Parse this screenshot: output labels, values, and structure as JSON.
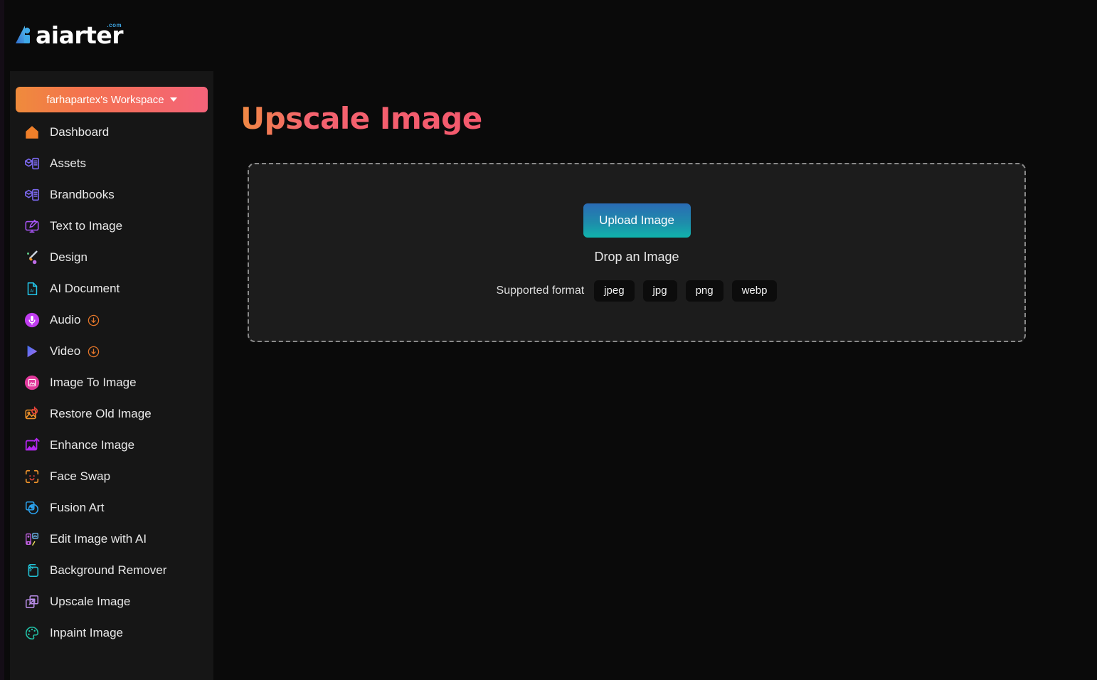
{
  "brand": {
    "name": "aiarter",
    "tld": ".com",
    "mark": "triangle-logo-icon"
  },
  "sidebar": {
    "workspace": {
      "label": "farhapartex's Workspace",
      "caret_icon": "chevron-down-icon",
      "gradient_from": "#ef8b3c",
      "gradient_to": "#f4637a"
    },
    "items": [
      {
        "label": "Dashboard",
        "icon": "home-icon",
        "color": "#ef7f2a",
        "badge": null
      },
      {
        "label": "Assets",
        "icon": "assets-box-list-icon",
        "color": "#7b68ee",
        "badge": null
      },
      {
        "label": "Brandbooks",
        "icon": "brandbook-box-list-icon",
        "color": "#7b68ee",
        "badge": null
      },
      {
        "label": "Text to Image",
        "icon": "monitor-pen-icon",
        "color": "#a855f7",
        "badge": null
      },
      {
        "label": "Design",
        "icon": "paintbrush-icon",
        "color": "#e07a5f",
        "badge": null
      },
      {
        "label": "AI Document",
        "icon": "ai-document-icon",
        "color": "#22c3e6",
        "badge": null
      },
      {
        "label": "Audio",
        "icon": "microphone-icon",
        "color": "#c03cf0",
        "badge": "download-circle-icon"
      },
      {
        "label": "Video",
        "icon": "play-triangle-icon",
        "color": "#4a7df0",
        "badge": "download-circle-icon"
      },
      {
        "label": "Image To Image",
        "icon": "image-to-image-icon",
        "color": "#e0399b",
        "badge": null
      },
      {
        "label": "Restore Old Image",
        "icon": "restore-image-icon",
        "color": "#f0932b",
        "badge": null
      },
      {
        "label": "Enhance Image",
        "icon": "enhance-image-icon",
        "color": "#b327f0",
        "badge": null
      },
      {
        "label": "Face Swap",
        "icon": "face-swap-icon",
        "color": "#f0662b",
        "badge": null
      },
      {
        "label": "Fusion Art",
        "icon": "fusion-art-icon",
        "color": "#2ba3f0",
        "badge": null
      },
      {
        "label": "Edit Image with AI",
        "icon": "edit-image-ai-icon",
        "color": "#c060e0",
        "badge": null
      },
      {
        "label": "Background Remover",
        "icon": "background-remover-icon",
        "color": "#22c3d6",
        "badge": null
      },
      {
        "label": "Upscale Image",
        "icon": "upscale-image-icon",
        "color": "#b98de8",
        "badge": null
      },
      {
        "label": "Inpaint Image",
        "icon": "palette-icon",
        "color": "#22c3a8",
        "badge": null
      }
    ]
  },
  "main": {
    "title": "Upscale Image",
    "dropzone": {
      "upload_button": "Upload Image",
      "drop_text": "Drop an Image",
      "formats_label": "Supported format",
      "formats": [
        "jpeg",
        "jpg",
        "png",
        "webp"
      ]
    }
  }
}
